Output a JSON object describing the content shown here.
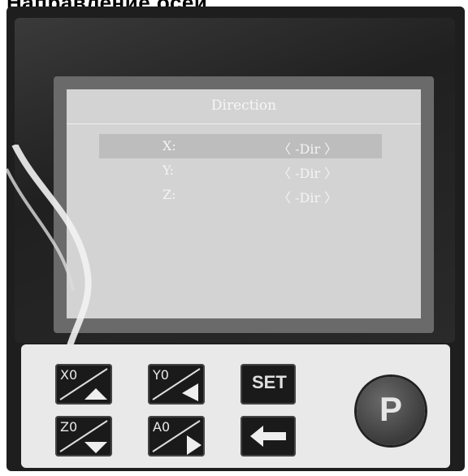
{
  "caption": "Направление осей",
  "screen": {
    "title": "Direction",
    "rows": [
      {
        "label": "X:",
        "value": "〈 -Dir 〉",
        "selected": true
      },
      {
        "label": "Y:",
        "value": "〈 -Dir 〉",
        "selected": false
      },
      {
        "label": "Z:",
        "value": "〈 -Dir 〉",
        "selected": false
      }
    ]
  },
  "keys": {
    "x0": {
      "label": "X0",
      "icon": "up-triangle-icon"
    },
    "y0": {
      "label": "Y0",
      "icon": "left-triangle-icon"
    },
    "set": {
      "label": "SET"
    },
    "z0": {
      "label": "Z0",
      "icon": "down-triangle-icon"
    },
    "a0": {
      "label": "A0",
      "icon": "right-triangle-icon"
    },
    "back": {
      "icon": "left-arrow-icon"
    },
    "p": {
      "label": "P"
    }
  }
}
